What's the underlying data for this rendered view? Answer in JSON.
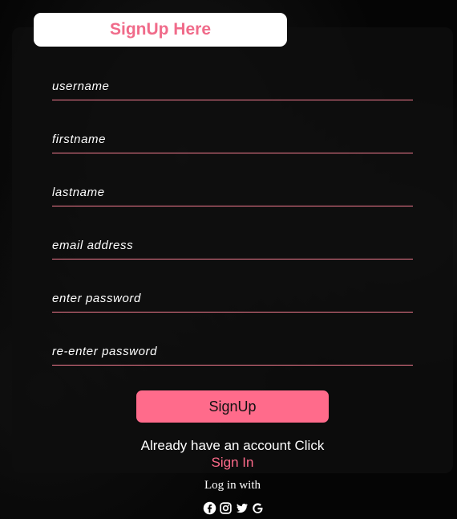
{
  "header": {
    "title": "SignUp Here"
  },
  "form": {
    "username_placeholder": "username",
    "firstname_placeholder": "firstname",
    "lastname_placeholder": "lastname",
    "email_placeholder": "email address",
    "password_placeholder": "enter password",
    "repassword_placeholder": "re-enter password",
    "submit_label": "SignUp"
  },
  "footer": {
    "already_text": "Already have an account Click",
    "signin_label": "Sign In",
    "login_with": "Log in with",
    "social_icons": [
      "facebook-icon",
      "instagram-icon",
      "twitter-icon",
      "google-icon"
    ]
  },
  "colors": {
    "accent": "#ff6b8b",
    "title_text": "#f06b8a",
    "underline": "#f27a8e",
    "background": "#000000"
  }
}
